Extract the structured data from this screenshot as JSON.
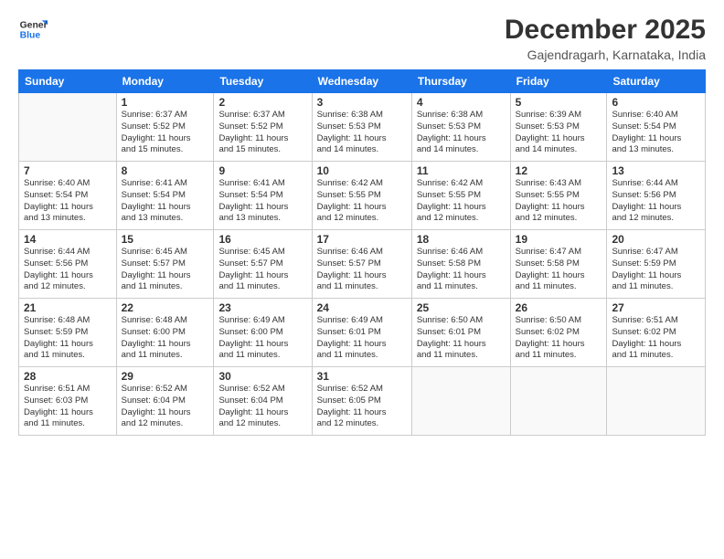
{
  "logo": {
    "line1": "General",
    "line2": "Blue"
  },
  "title": "December 2025",
  "location": "Gajendragarh, Karnataka, India",
  "header_days": [
    "Sunday",
    "Monday",
    "Tuesday",
    "Wednesday",
    "Thursday",
    "Friday",
    "Saturday"
  ],
  "weeks": [
    [
      {
        "day": "",
        "info": ""
      },
      {
        "day": "1",
        "info": "Sunrise: 6:37 AM\nSunset: 5:52 PM\nDaylight: 11 hours\nand 15 minutes."
      },
      {
        "day": "2",
        "info": "Sunrise: 6:37 AM\nSunset: 5:52 PM\nDaylight: 11 hours\nand 15 minutes."
      },
      {
        "day": "3",
        "info": "Sunrise: 6:38 AM\nSunset: 5:53 PM\nDaylight: 11 hours\nand 14 minutes."
      },
      {
        "day": "4",
        "info": "Sunrise: 6:38 AM\nSunset: 5:53 PM\nDaylight: 11 hours\nand 14 minutes."
      },
      {
        "day": "5",
        "info": "Sunrise: 6:39 AM\nSunset: 5:53 PM\nDaylight: 11 hours\nand 14 minutes."
      },
      {
        "day": "6",
        "info": "Sunrise: 6:40 AM\nSunset: 5:54 PM\nDaylight: 11 hours\nand 13 minutes."
      }
    ],
    [
      {
        "day": "7",
        "info": "Sunrise: 6:40 AM\nSunset: 5:54 PM\nDaylight: 11 hours\nand 13 minutes."
      },
      {
        "day": "8",
        "info": "Sunrise: 6:41 AM\nSunset: 5:54 PM\nDaylight: 11 hours\nand 13 minutes."
      },
      {
        "day": "9",
        "info": "Sunrise: 6:41 AM\nSunset: 5:54 PM\nDaylight: 11 hours\nand 13 minutes."
      },
      {
        "day": "10",
        "info": "Sunrise: 6:42 AM\nSunset: 5:55 PM\nDaylight: 11 hours\nand 12 minutes."
      },
      {
        "day": "11",
        "info": "Sunrise: 6:42 AM\nSunset: 5:55 PM\nDaylight: 11 hours\nand 12 minutes."
      },
      {
        "day": "12",
        "info": "Sunrise: 6:43 AM\nSunset: 5:55 PM\nDaylight: 11 hours\nand 12 minutes."
      },
      {
        "day": "13",
        "info": "Sunrise: 6:44 AM\nSunset: 5:56 PM\nDaylight: 11 hours\nand 12 minutes."
      }
    ],
    [
      {
        "day": "14",
        "info": "Sunrise: 6:44 AM\nSunset: 5:56 PM\nDaylight: 11 hours\nand 12 minutes."
      },
      {
        "day": "15",
        "info": "Sunrise: 6:45 AM\nSunset: 5:57 PM\nDaylight: 11 hours\nand 11 minutes."
      },
      {
        "day": "16",
        "info": "Sunrise: 6:45 AM\nSunset: 5:57 PM\nDaylight: 11 hours\nand 11 minutes."
      },
      {
        "day": "17",
        "info": "Sunrise: 6:46 AM\nSunset: 5:57 PM\nDaylight: 11 hours\nand 11 minutes."
      },
      {
        "day": "18",
        "info": "Sunrise: 6:46 AM\nSunset: 5:58 PM\nDaylight: 11 hours\nand 11 minutes."
      },
      {
        "day": "19",
        "info": "Sunrise: 6:47 AM\nSunset: 5:58 PM\nDaylight: 11 hours\nand 11 minutes."
      },
      {
        "day": "20",
        "info": "Sunrise: 6:47 AM\nSunset: 5:59 PM\nDaylight: 11 hours\nand 11 minutes."
      }
    ],
    [
      {
        "day": "21",
        "info": "Sunrise: 6:48 AM\nSunset: 5:59 PM\nDaylight: 11 hours\nand 11 minutes."
      },
      {
        "day": "22",
        "info": "Sunrise: 6:48 AM\nSunset: 6:00 PM\nDaylight: 11 hours\nand 11 minutes."
      },
      {
        "day": "23",
        "info": "Sunrise: 6:49 AM\nSunset: 6:00 PM\nDaylight: 11 hours\nand 11 minutes."
      },
      {
        "day": "24",
        "info": "Sunrise: 6:49 AM\nSunset: 6:01 PM\nDaylight: 11 hours\nand 11 minutes."
      },
      {
        "day": "25",
        "info": "Sunrise: 6:50 AM\nSunset: 6:01 PM\nDaylight: 11 hours\nand 11 minutes."
      },
      {
        "day": "26",
        "info": "Sunrise: 6:50 AM\nSunset: 6:02 PM\nDaylight: 11 hours\nand 11 minutes."
      },
      {
        "day": "27",
        "info": "Sunrise: 6:51 AM\nSunset: 6:02 PM\nDaylight: 11 hours\nand 11 minutes."
      }
    ],
    [
      {
        "day": "28",
        "info": "Sunrise: 6:51 AM\nSunset: 6:03 PM\nDaylight: 11 hours\nand 11 minutes."
      },
      {
        "day": "29",
        "info": "Sunrise: 6:52 AM\nSunset: 6:04 PM\nDaylight: 11 hours\nand 12 minutes."
      },
      {
        "day": "30",
        "info": "Sunrise: 6:52 AM\nSunset: 6:04 PM\nDaylight: 11 hours\nand 12 minutes."
      },
      {
        "day": "31",
        "info": "Sunrise: 6:52 AM\nSunset: 6:05 PM\nDaylight: 11 hours\nand 12 minutes."
      },
      {
        "day": "",
        "info": ""
      },
      {
        "day": "",
        "info": ""
      },
      {
        "day": "",
        "info": ""
      }
    ]
  ]
}
